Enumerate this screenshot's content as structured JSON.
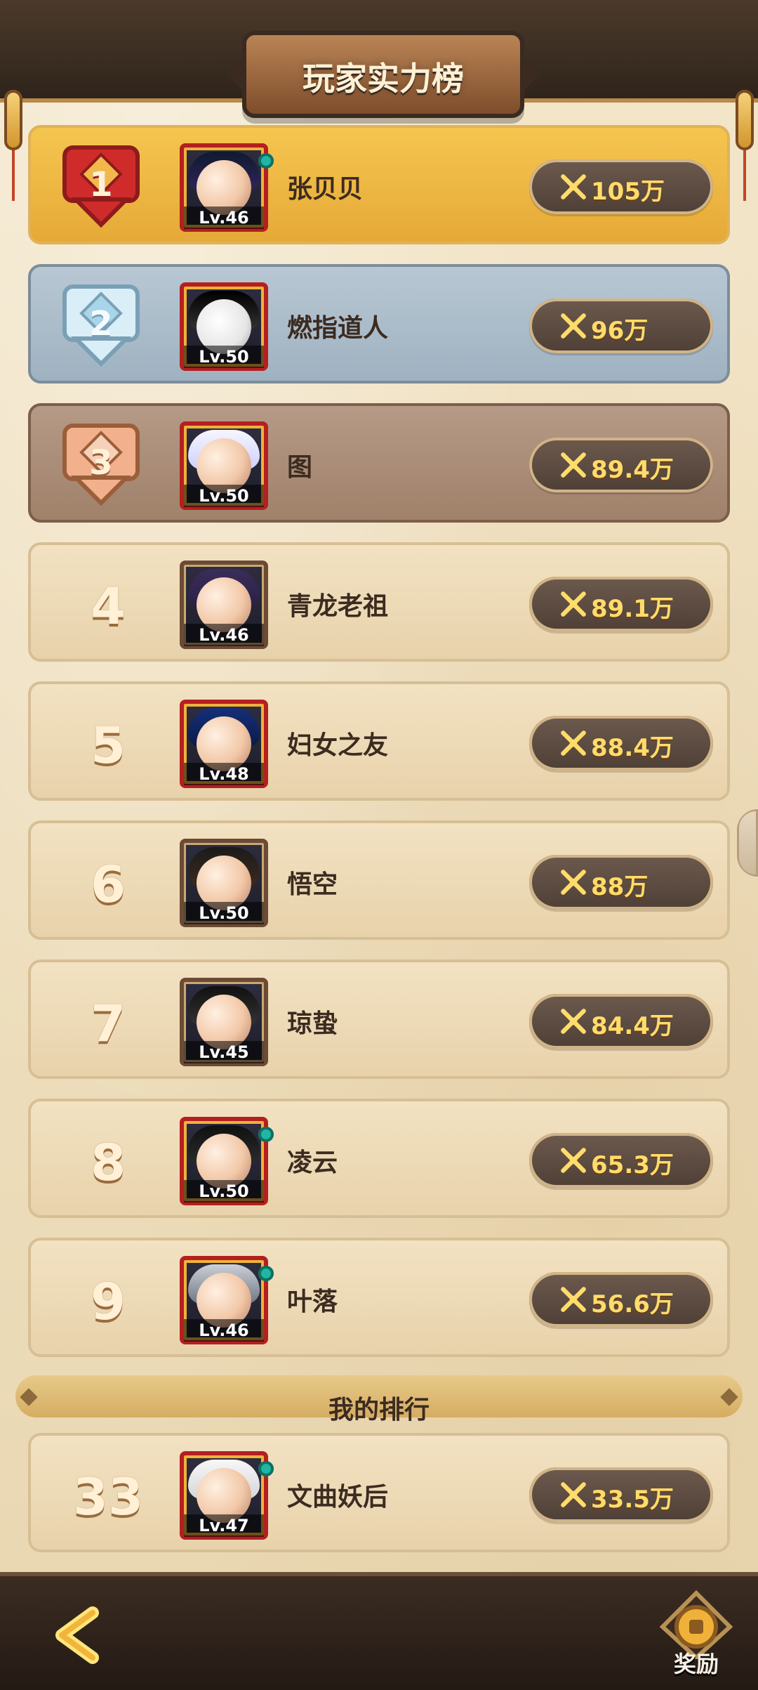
{
  "header": {
    "title": "玩家实力榜"
  },
  "ranking": {
    "top_list": [
      {
        "rank": "1",
        "name": "张贝贝",
        "level": "Lv.46",
        "power": "105万"
      },
      {
        "rank": "2",
        "name": "燃指道人",
        "level": "Lv.50",
        "power": "96万"
      },
      {
        "rank": "3",
        "name": "图",
        "level": "Lv.50",
        "power": "89.4万"
      },
      {
        "rank": "4",
        "name": "青龙老祖",
        "level": "Lv.46",
        "power": "89.1万"
      },
      {
        "rank": "5",
        "name": "妇女之友",
        "level": "Lv.48",
        "power": "88.4万"
      },
      {
        "rank": "6",
        "name": "悟空",
        "level": "Lv.50",
        "power": "88万"
      },
      {
        "rank": "7",
        "name": "琼蛰",
        "level": "Lv.45",
        "power": "84.4万"
      },
      {
        "rank": "8",
        "name": "凌云",
        "level": "Lv.50",
        "power": "65.3万"
      },
      {
        "rank": "9",
        "name": "叶落",
        "level": "Lv.46",
        "power": "56.6万"
      }
    ],
    "my_rank_header": "我的排行",
    "my_rank": {
      "rank": "33",
      "name": "文曲妖后",
      "level": "Lv.47",
      "power": "33.5万"
    }
  },
  "footer": {
    "reward_label": "奖励"
  },
  "icons": {
    "back": "back-arrow-icon",
    "reward": "coin-reward-icon",
    "power": "crossed-swords-icon"
  },
  "colors": {
    "gold_row": "#f5c64f",
    "silver_row": "#b8c7d3",
    "bronze_row": "#b59a87",
    "power_text": "#ffdc6a"
  }
}
